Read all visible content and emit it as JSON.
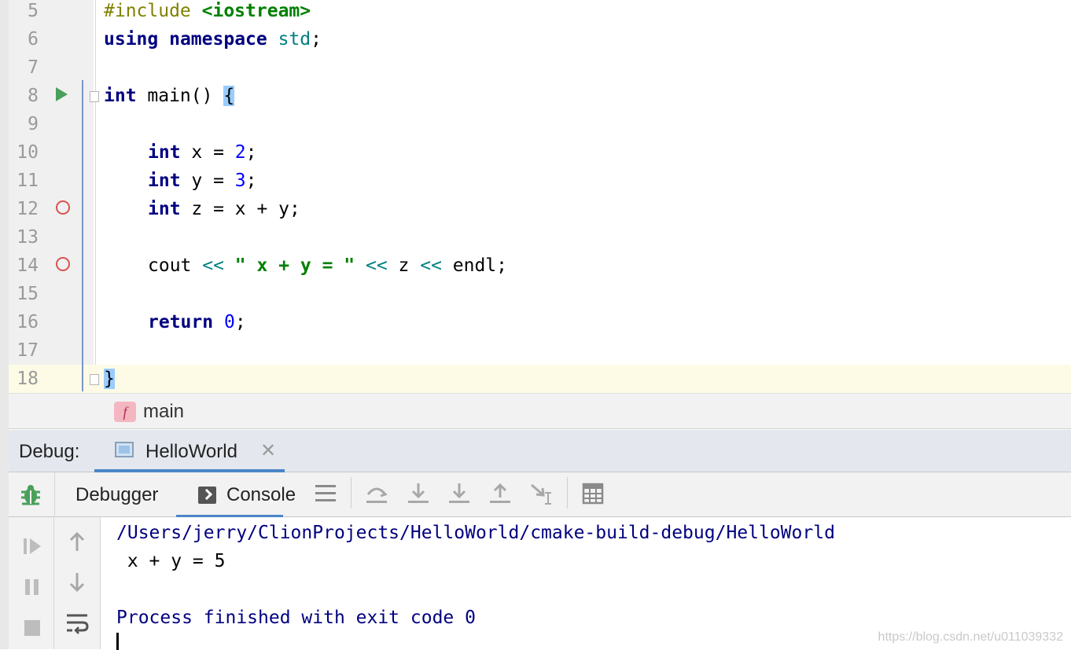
{
  "editor": {
    "lines": [
      {
        "num": "5"
      },
      {
        "num": "6"
      },
      {
        "num": "7"
      },
      {
        "num": "8"
      },
      {
        "num": "9"
      },
      {
        "num": "10"
      },
      {
        "num": "11"
      },
      {
        "num": "12"
      },
      {
        "num": "13"
      },
      {
        "num": "14"
      },
      {
        "num": "15"
      },
      {
        "num": "16"
      },
      {
        "num": "17"
      },
      {
        "num": "18"
      }
    ],
    "code": {
      "l5_directive": "#include",
      "l5_header": "<iostream>",
      "l6_using": "using",
      "l6_namespace": "namespace",
      "l6_std": "std",
      "l6_semi": ";",
      "l8_int": "int",
      "l8_rest": " main() ",
      "l8_brace": "{",
      "l10_int": "int",
      "l10_mid": " x = ",
      "l10_val": "2",
      "l10_end": ";",
      "l11_int": "int",
      "l11_mid": " y = ",
      "l11_val": "3",
      "l11_end": ";",
      "l12_int": "int",
      "l12_rest": " z = x + y;",
      "l14_cout": "cout ",
      "l14_op1": "<<",
      "l14_str": " \" x + y = \" ",
      "l14_op2": "<<",
      "l14_z": " z ",
      "l14_op3": "<<",
      "l14_endl": " endl;",
      "l16_return": "return",
      "l16_val": "0",
      "l16_end": ";",
      "l18_brace": "}"
    },
    "current_line": "18",
    "breakpoint_lines": [
      "12",
      "14"
    ],
    "run_marker_line": "8"
  },
  "breadcrumb": {
    "badge": "f",
    "label": "main"
  },
  "debug": {
    "label": "Debug:",
    "session_tab": "HelloWorld",
    "tabs": [
      "Debugger",
      "Console"
    ],
    "active_tab": "Console"
  },
  "console": {
    "path": "/Users/jerry/ClionProjects/HelloWorld/cmake-build-debug/HelloWorld",
    "output": " x + y = 5",
    "exit": "Process finished with exit code 0"
  },
  "watermark": "https://blog.csdn.net/u011039332",
  "colors": {
    "keyword": "#000080",
    "string": "#008000",
    "number": "#0000ff",
    "breakpoint": "#d9534f",
    "run": "#4aa05a",
    "accent": "#4a86c7",
    "current_line_bg": "#fdfbe6"
  }
}
